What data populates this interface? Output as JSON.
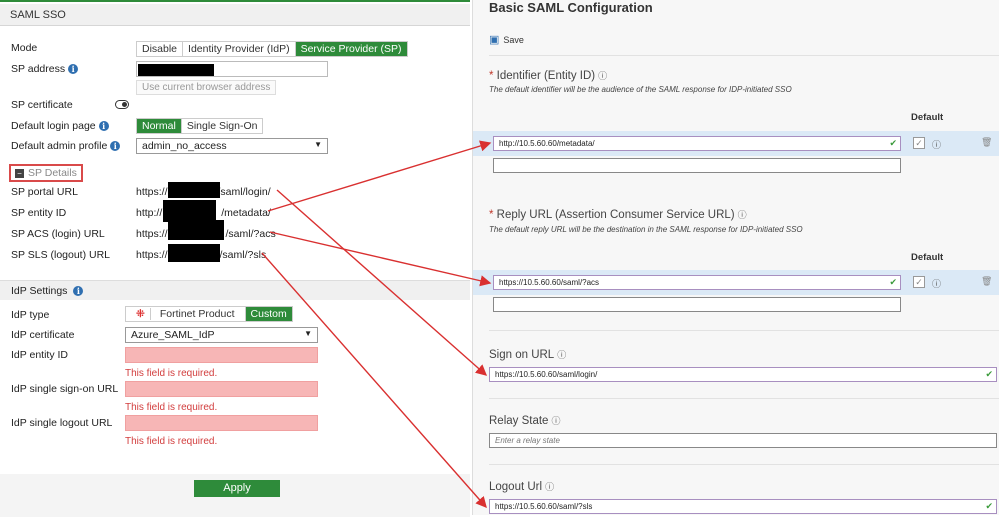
{
  "left": {
    "header": "SAML SSO",
    "mode_label": "Mode",
    "mode_options": [
      "Disable",
      "Identity Provider (IdP)",
      "Service Provider (SP)"
    ],
    "sp_address_label": "SP address",
    "use_current_btn": "Use current browser address",
    "sp_cert_label": "SP certificate",
    "default_login_label": "Default login page",
    "login_options": [
      "Normal",
      "Single Sign-On"
    ],
    "default_admin_label": "Default admin profile",
    "default_admin_value": "admin_no_access",
    "sp_details": "SP Details",
    "sp_rows": [
      {
        "label": "SP portal URL",
        "pre": "https://",
        "post": "/saml/login/"
      },
      {
        "label": "SP entity ID",
        "pre": "http://",
        "post": "/metadata/"
      },
      {
        "label": "SP ACS (login) URL",
        "pre": "https://",
        "post": "/saml/?acs"
      },
      {
        "label": "SP SLS (logout) URL",
        "pre": "https://",
        "post": "/saml/?sls"
      }
    ],
    "idp_settings": "IdP Settings",
    "idp_type_label": "IdP type",
    "idp_type_options": [
      "Fortinet Product",
      "Custom"
    ],
    "idp_cert_label": "IdP certificate",
    "idp_cert_value": "Azure_SAML_IdP",
    "idp_entity_label": "IdP entity ID",
    "idp_sso_label": "IdP single sign-on URL",
    "idp_slo_label": "IdP single logout URL",
    "required_msg": "This field is required.",
    "apply": "Apply",
    "accent": "#2e8b3a"
  },
  "right": {
    "title": "Basic SAML Configuration",
    "save": "Save",
    "identifier_label": "Identifier (Entity ID)",
    "identifier_hint": "The default identifier will be the audience of the SAML response for IDP-initiated SSO",
    "default_header": "Default",
    "identifier_value": "http://10.5.60.60/metadata/",
    "reply_label": "Reply URL (Assertion Consumer Service URL)",
    "reply_hint": "The default reply URL will be the destination in the SAML response for IDP-initiated SSO",
    "reply_value": "https://10.5.60.60/saml/?acs",
    "signon_label": "Sign on URL",
    "signon_value": "https://10.5.60.60/saml/login/",
    "relay_label": "Relay State",
    "relay_placeholder": "Enter a relay state",
    "logout_label": "Logout Url",
    "logout_value": "https://10.5.60.60/saml/?sls"
  }
}
